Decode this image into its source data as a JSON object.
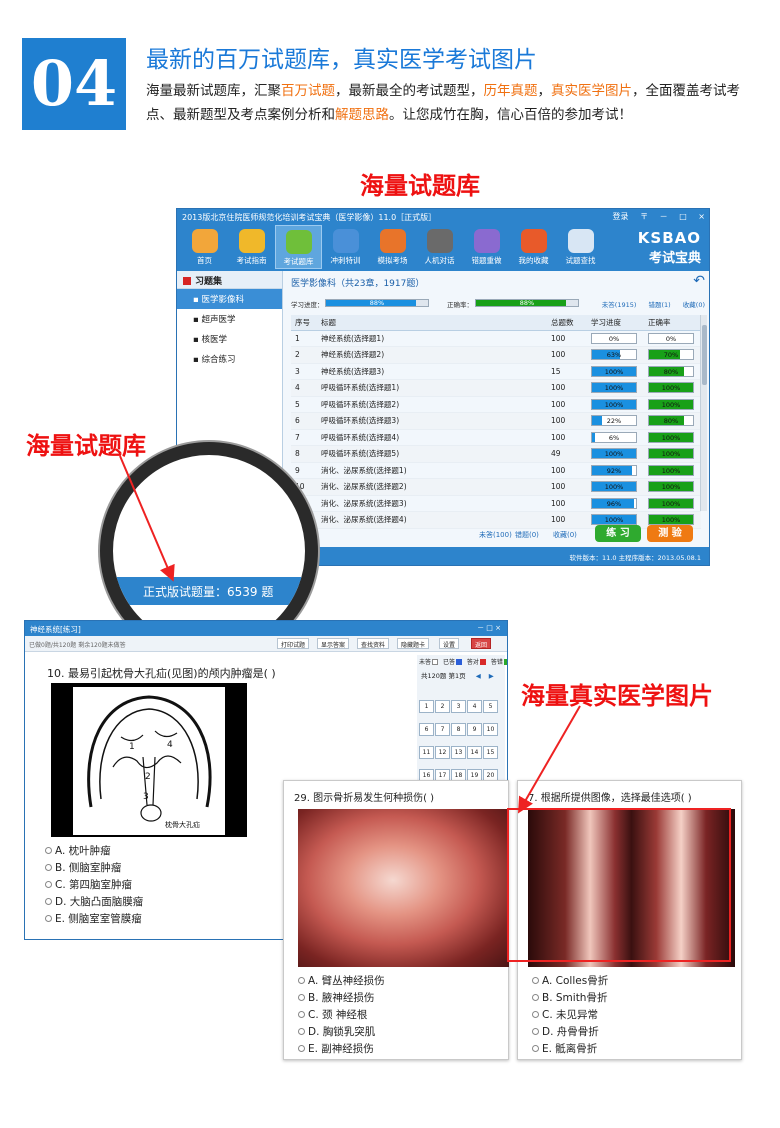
{
  "header": {
    "number": "04",
    "title": "最新的百万试题库，真实医学考试图片",
    "desc": [
      {
        "t": "海量最新试题库，汇聚",
        "hl": false
      },
      {
        "t": "百万试题",
        "hl": true
      },
      {
        "t": "，最新最全的考试题型，",
        "hl": false
      },
      {
        "t": "历年真题",
        "hl": true
      },
      {
        "t": "，",
        "hl": false
      },
      {
        "t": "真实医学图片",
        "hl": true
      },
      {
        "t": "，全面覆盖考试考点、最新题型及考点案例分析和",
        "hl": false
      },
      {
        "t": "解题思路",
        "hl": true
      },
      {
        "t": "。让您成竹在胸，信心百倍的参加考试！",
        "hl": false
      }
    ]
  },
  "captions": {
    "top": "海量试题库",
    "left": "海量试题库",
    "right": "海量真实医学图片"
  },
  "colors": {
    "accent": "#1f7fd0",
    "highlight": "#f07010",
    "caption_red": "#ee1111",
    "bar_blue": "#1a90e0",
    "bar_green": "#18a018"
  },
  "win1": {
    "title": "2013版北京住院医师规范化培训考试宝典（医学影像）11.0［正式版］",
    "ctrls": [
      "登录",
      "〒",
      "－",
      "□",
      "×"
    ],
    "toolbar": [
      {
        "label": "首页",
        "icon": "home-icon",
        "color": "#f2a63a"
      },
      {
        "label": "考试指南",
        "icon": "compass-icon",
        "color": "#f0b82a"
      },
      {
        "label": "考试题库",
        "icon": "books-icon",
        "color": "#6fbf3a",
        "active": true
      },
      {
        "label": "冲刺特训",
        "icon": "globe-icon",
        "color": "#4a90d8"
      },
      {
        "label": "模拟考场",
        "icon": "clock-icon",
        "color": "#e8742a"
      },
      {
        "label": "人机对话",
        "icon": "chess-icon",
        "color": "#6a6a6a"
      },
      {
        "label": "错题重做",
        "icon": "pen-icon",
        "color": "#8a6ad0"
      },
      {
        "label": "我的收藏",
        "icon": "gift-icon",
        "color": "#e85a2a"
      },
      {
        "label": "试题查找",
        "icon": "search-icon",
        "color": "#d8e6f4"
      }
    ],
    "brand_en": "KSBAO",
    "brand_cn": "考试宝典",
    "sidebar": {
      "head": "习题集",
      "items": [
        "医学影像科",
        "超声医学",
        "核医学",
        "综合练习"
      ]
    },
    "subject": "医学影像科（共23章，1917题）",
    "progress": {
      "study_label": "学习进度：",
      "study_value": "88%",
      "study_fraction": 0.88,
      "correct_label": "正确率：",
      "correct_value": "88%",
      "correct_fraction": 0.88
    },
    "links": [
      "未答(1915)",
      "错题(1)",
      "收藏(0)"
    ],
    "columns": [
      "序号",
      "标题",
      "总题数",
      "学习进度",
      "正确率"
    ],
    "rows": [
      {
        "no": "1",
        "title": "神经系统(选择题1)",
        "total": "100",
        "prog": "0%",
        "prog_f": 0.0,
        "acc": "0%",
        "acc_f": 0.0
      },
      {
        "no": "2",
        "title": "神经系统(选择题2)",
        "total": "100",
        "prog": "63%",
        "prog_f": 0.63,
        "acc": "70%",
        "acc_f": 0.7
      },
      {
        "no": "3",
        "title": "神经系统(选择题3)",
        "total": "15",
        "prog": "100%",
        "prog_f": 1.0,
        "acc": "80%",
        "acc_f": 0.8
      },
      {
        "no": "4",
        "title": "呼吸循环系统(选择题1)",
        "total": "100",
        "prog": "100%",
        "prog_f": 1.0,
        "acc": "100%",
        "acc_f": 1.0
      },
      {
        "no": "5",
        "title": "呼吸循环系统(选择题2)",
        "total": "100",
        "prog": "100%",
        "prog_f": 1.0,
        "acc": "100%",
        "acc_f": 1.0
      },
      {
        "no": "6",
        "title": "呼吸循环系统(选择题3)",
        "total": "100",
        "prog": "22%",
        "prog_f": 0.22,
        "acc": "80%",
        "acc_f": 0.8
      },
      {
        "no": "7",
        "title": "呼吸循环系统(选择题4)",
        "total": "100",
        "prog": "6%",
        "prog_f": 0.06,
        "acc": "100%",
        "acc_f": 1.0
      },
      {
        "no": "8",
        "title": "呼吸循环系统(选择题5)",
        "total": "49",
        "prog": "100%",
        "prog_f": 1.0,
        "acc": "100%",
        "acc_f": 1.0
      },
      {
        "no": "9",
        "title": "消化、泌尿系统(选择题1)",
        "total": "100",
        "prog": "92%",
        "prog_f": 0.92,
        "acc": "100%",
        "acc_f": 1.0
      },
      {
        "no": "10",
        "title": "消化、泌尿系统(选择题2)",
        "total": "100",
        "prog": "100%",
        "prog_f": 1.0,
        "acc": "100%",
        "acc_f": 1.0
      },
      {
        "no": "11",
        "title": "消化、泌尿系统(选择题3)",
        "total": "100",
        "prog": "96%",
        "prog_f": 0.96,
        "acc": "100%",
        "acc_f": 1.0
      },
      {
        "no": "12",
        "title": "消化、泌尿系统(选择题4)",
        "total": "100",
        "prog": "100%",
        "prog_f": 1.0,
        "acc": "100%",
        "acc_f": 1.0
      }
    ],
    "footer": {
      "unanswered": "未答(100)",
      "wrong": "错题(0)",
      "fav": "收藏(0)",
      "practice": "练 习",
      "test": "测 验"
    },
    "status": "软件版本：11.0  主程序版本：2013.05.08.1"
  },
  "magnifier_text": "正式版试题量：6539 题",
  "win2": {
    "title": "神经系统[练习]",
    "ctrls": "－ □ ×",
    "info": "已做0题/共120题    剩余120题未做答",
    "tools": [
      "打印试题",
      "显示答案",
      "查找资料",
      "隐藏题卡",
      "设置",
      "返回"
    ],
    "question": "10. 最易引起枕骨大孔疝(见图)的颅内肿瘤是(    )",
    "image_caption": "枕骨大孔疝",
    "options": [
      "A. 枕叶肿瘤",
      "B. 侧脑室肿瘤",
      "C. 第四脑室肿瘤",
      "D. 大脑凸面脑膜瘤",
      "E. 侧脑室室管膜瘤"
    ],
    "legend": [
      "未答",
      "已答",
      "答对",
      "答错"
    ],
    "page": "共120题  第1页",
    "grid": [
      "1",
      "2",
      "3",
      "4",
      "5",
      "6",
      "7",
      "8",
      "9",
      "10",
      "11",
      "12",
      "13",
      "14",
      "15",
      "16",
      "17",
      "18",
      "19",
      "20",
      "21",
      "22",
      "23",
      "24",
      "25",
      "26",
      "27",
      "28",
      "29",
      "30"
    ]
  },
  "xray1": {
    "question": "29. 图示骨折易发生何种损伤(    )",
    "options": [
      "A. 臂丛神经损伤",
      "B. 腋神经损伤",
      "C. 颈   神经根",
      "D. 胸锁乳突肌",
      "E. 副神经损伤"
    ]
  },
  "xray2": {
    "question": "7. 根据所提供图像，选择最佳选项(    )",
    "options": [
      "A. Colles骨折",
      "B. Smith骨折",
      "C. 未见异常",
      "D. 舟骨骨折",
      "E. 骶离骨折"
    ]
  }
}
